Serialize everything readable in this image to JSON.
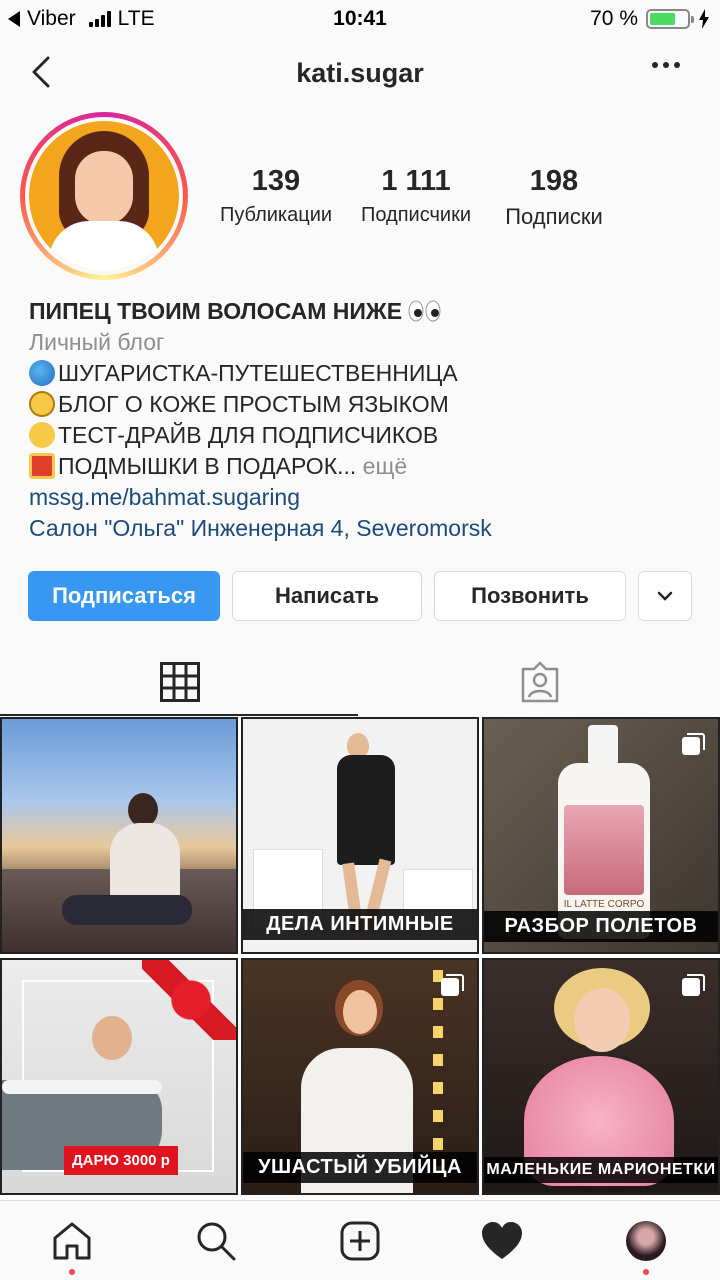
{
  "status_bar": {
    "back_app": "Viber",
    "network": "LTE",
    "time": "10:41",
    "battery_text": "70 %",
    "battery_level": 0.7
  },
  "nav": {
    "title": "kati.sugar"
  },
  "stats": [
    {
      "value": "139",
      "label": "Публикации"
    },
    {
      "value": "1 111",
      "label": "Подписчики"
    },
    {
      "value": "198",
      "label": "Подписки"
    }
  ],
  "bio": {
    "name": "ПИПЕЦ ТВОИМ ВОЛОСАМ НИЖЕ",
    "category": "Личный блог",
    "lines": [
      "ШУГАРИСТКА-ПУТЕШЕСТВЕННИЦА",
      "БЛОГ О КОЖЕ ПРОСТЫМ ЯЗЫКОМ",
      "ТЕСТ-ДРАЙВ ДЛЯ ПОДПИСЧИКОВ",
      "ПОДМЫШКИ В ПОДАРОК..."
    ],
    "more": "ещё",
    "link": "mssg.me/bahmat.sugaring",
    "location": "Салон \"Ольга\" Инженерная 4, Severomorsk"
  },
  "actions": {
    "follow": "Подписаться",
    "message": "Написать",
    "call": "Позвонить"
  },
  "grid": {
    "captions": {
      "post2": "ДЕЛА ИНТИМНЫЕ",
      "post3": "РАЗБОР ПОЛЕТОВ",
      "post4": "ДАРЮ 3000 р",
      "post5": "УШАСТЫЙ УБИЙЦА",
      "post6": "МАЛЕНЬКИЕ МАРИОНЕТКИ"
    },
    "product_label": "IL LATTE CORPO"
  },
  "colors": {
    "accent": "#3897f0",
    "link": "#1c4a7a",
    "notification_dot": "#ed4956"
  }
}
